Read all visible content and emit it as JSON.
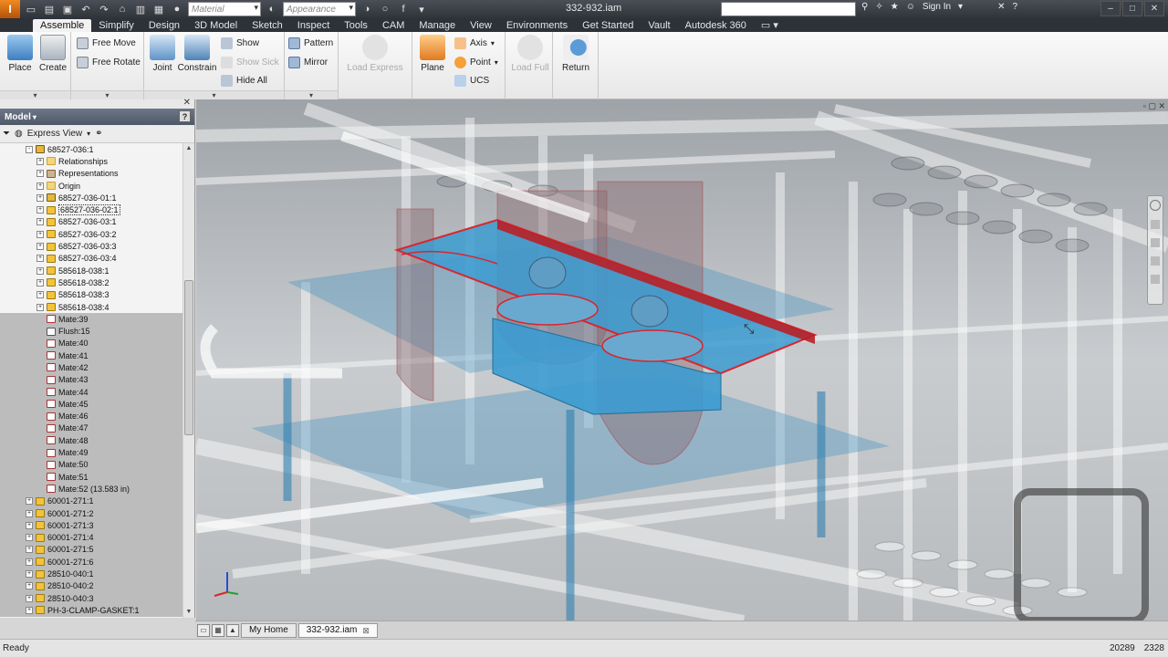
{
  "app": {
    "logo_letter": "I",
    "document_title": "332-932.iam"
  },
  "quick_access": {
    "material_placeholder": "Material",
    "appearance_placeholder": "Appearance",
    "fx_label": "f"
  },
  "header_right": {
    "sign_in": "Sign In",
    "help": "?"
  },
  "tabs": [
    "Assemble",
    "Simplify",
    "Design",
    "3D Model",
    "Sketch",
    "Inspect",
    "Tools",
    "CAM",
    "Manage",
    "View",
    "Environments",
    "Get Started",
    "Vault",
    "Autodesk 360"
  ],
  "ribbon": {
    "place": "Place",
    "create": "Create",
    "free_move": "Free Move",
    "free_rotate": "Free Rotate",
    "joint": "Joint",
    "constrain": "Constrain",
    "show": "Show",
    "show_sick": "Show Sick",
    "hide_all": "Hide All",
    "pattern": "Pattern",
    "mirror": "Mirror",
    "load_express": "Load Express",
    "plane": "Plane",
    "axis": "Axis",
    "point": "Point",
    "ucs": "UCS",
    "load_full": "Load Full",
    "return": "Return"
  },
  "browser": {
    "title": "Model",
    "view_mode": "Express View",
    "help": "?",
    "nodes": [
      {
        "label": "68527-036:1",
        "type": "sub",
        "exp": "-",
        "indent": 2
      },
      {
        "label": "Relationships",
        "type": "folder",
        "exp": "+",
        "indent": 3
      },
      {
        "label": "Representations",
        "type": "rep",
        "exp": "+",
        "indent": 3
      },
      {
        "label": "Origin",
        "type": "folder",
        "exp": "+",
        "indent": 3
      },
      {
        "label": "68527-036-01:1",
        "type": "sub",
        "exp": "+",
        "indent": 3
      },
      {
        "label": "68527-036-02:1",
        "type": "part",
        "exp": "+",
        "indent": 3,
        "selected": true
      },
      {
        "label": "68527-036-03:1",
        "type": "part",
        "exp": "+",
        "indent": 3
      },
      {
        "label": "68527-036-03:2",
        "type": "part",
        "exp": "+",
        "indent": 3
      },
      {
        "label": "68527-036-03:3",
        "type": "part",
        "exp": "+",
        "indent": 3
      },
      {
        "label": "68527-036-03:4",
        "type": "part",
        "exp": "+",
        "indent": 3
      },
      {
        "label": "585618-038:1",
        "type": "part",
        "exp": "+",
        "indent": 3
      },
      {
        "label": "585618-038:2",
        "type": "part",
        "exp": "+",
        "indent": 3
      },
      {
        "label": "585618-038:3",
        "type": "part",
        "exp": "+",
        "indent": 3
      },
      {
        "label": "585618-038:4",
        "type": "part",
        "exp": "+",
        "indent": 3
      },
      {
        "label": "Mate:39",
        "type": "mate",
        "indent": 3,
        "gray": true
      },
      {
        "label": "Flush:15",
        "type": "flush",
        "indent": 3,
        "gray": true
      },
      {
        "label": "Mate:40",
        "type": "mate",
        "indent": 3,
        "gray": true
      },
      {
        "label": "Mate:41",
        "type": "mate",
        "indent": 3,
        "gray": true
      },
      {
        "label": "Mate:42",
        "type": "mate",
        "indent": 3,
        "gray": true
      },
      {
        "label": "Mate:43",
        "type": "mate",
        "indent": 3,
        "gray": true
      },
      {
        "label": "Mate:44",
        "type": "mate",
        "indent": 3,
        "gray": true
      },
      {
        "label": "Mate:45",
        "type": "mate",
        "indent": 3,
        "gray": true
      },
      {
        "label": "Mate:46",
        "type": "mate",
        "indent": 3,
        "gray": true
      },
      {
        "label": "Mate:47",
        "type": "mate",
        "indent": 3,
        "gray": true
      },
      {
        "label": "Mate:48",
        "type": "mate",
        "indent": 3,
        "gray": true
      },
      {
        "label": "Mate:49",
        "type": "mate",
        "indent": 3,
        "gray": true
      },
      {
        "label": "Mate:50",
        "type": "mate",
        "indent": 3,
        "gray": true
      },
      {
        "label": "Mate:51",
        "type": "mate",
        "indent": 3,
        "gray": true
      },
      {
        "label": "Mate:52 (13.583 in)",
        "type": "mate",
        "indent": 3,
        "gray": true
      },
      {
        "label": "60001-271:1",
        "type": "part",
        "exp": "+",
        "indent": 2,
        "gray": true
      },
      {
        "label": "60001-271:2",
        "type": "part",
        "exp": "+",
        "indent": 2,
        "gray": true
      },
      {
        "label": "60001-271:3",
        "type": "part",
        "exp": "+",
        "indent": 2,
        "gray": true
      },
      {
        "label": "60001-271:4",
        "type": "part",
        "exp": "+",
        "indent": 2,
        "gray": true
      },
      {
        "label": "60001-271:5",
        "type": "part",
        "exp": "+",
        "indent": 2,
        "gray": true
      },
      {
        "label": "60001-271:6",
        "type": "part",
        "exp": "+",
        "indent": 2,
        "gray": true
      },
      {
        "label": "28510-040:1",
        "type": "part",
        "exp": "+",
        "indent": 2,
        "gray": true
      },
      {
        "label": "28510-040:2",
        "type": "part",
        "exp": "+",
        "indent": 2,
        "gray": true
      },
      {
        "label": "28510-040:3",
        "type": "part",
        "exp": "+",
        "indent": 2,
        "gray": true
      },
      {
        "label": "PH-3-CLAMP-GASKET:1",
        "type": "part",
        "exp": "+",
        "indent": 2,
        "gray": true
      }
    ]
  },
  "doc_tabs": {
    "home": "My Home",
    "active": "332-932.iam"
  },
  "status": {
    "left": "Ready",
    "count1": "20289",
    "count2": "2328"
  },
  "colors": {
    "selection_red": "#d8262e",
    "plate_blue": "#2e8fc4",
    "ribbon_bg": "#f0f0f0"
  }
}
